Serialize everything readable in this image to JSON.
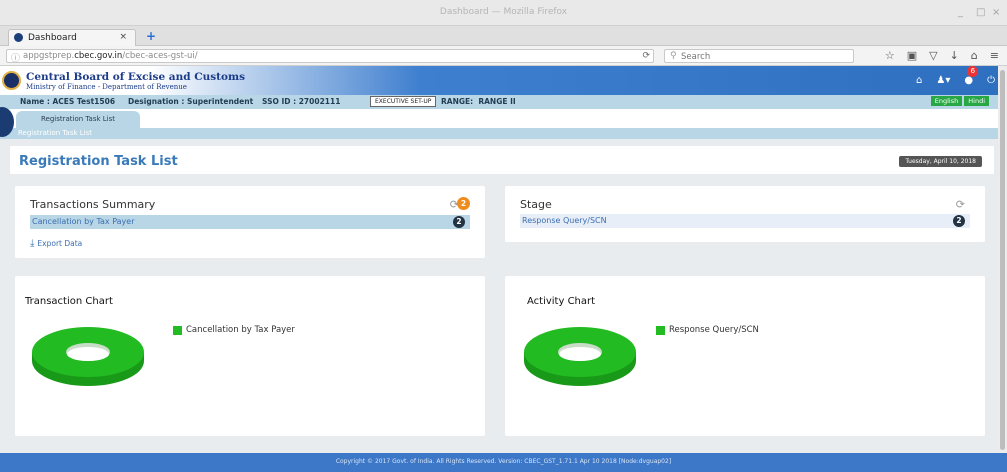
{
  "window": {
    "title": "Dashboard — Mozilla Firefox",
    "controls": [
      "_",
      "□",
      "×"
    ]
  },
  "browser": {
    "tab_label": "Dashboard",
    "tab_close": "×",
    "new_tab": "+",
    "url_prefix": "appgstprep.",
    "url_domain": "cbec.gov.in",
    "url_path": "/cbec-aces-gst-ui/",
    "search_placeholder": "Search",
    "icons": [
      "star-icon",
      "clipboard-icon",
      "pocket-icon",
      "download-icon",
      "home-icon",
      "menu-icon"
    ]
  },
  "header": {
    "org_name": "Central Board of Excise and Customs",
    "ministry": "Ministry of Finance - Department of Revenue",
    "notification_count": "6"
  },
  "infobar": {
    "name": "Name : ACES Test1506",
    "designation": "Designation : Superintendent",
    "sso": "SSO ID : 27002111",
    "exec_button": "EXECUTIVE SET-UP",
    "range": "RANGE:  RANGE II",
    "lang_en": "English",
    "lang_hi": "Hindi"
  },
  "nav": {
    "active_tab": "Registration Task List",
    "breadcrumb": "Registration Task List"
  },
  "page": {
    "title": "Registration Task List",
    "date": "Tuesday, April 10, 2018"
  },
  "transactions": {
    "title": "Transactions Summary",
    "total_badge": "2",
    "rows": [
      {
        "label": "Cancellation by Tax Payer",
        "count": "2"
      }
    ],
    "export_label": "Export Data"
  },
  "stage": {
    "title": "Stage",
    "rows": [
      {
        "label": "Response Query/SCN",
        "count": "2"
      }
    ]
  },
  "transaction_chart": {
    "title": "Transaction Chart",
    "legend": "Cancellation by Tax Payer",
    "color": "#22bb22"
  },
  "activity_chart": {
    "title": "Activity Chart",
    "legend": "Response Query/SCN",
    "color": "#22bb22"
  },
  "chart_data": [
    {
      "type": "pie",
      "title": "Transaction Chart",
      "categories": [
        "Cancellation by Tax Payer"
      ],
      "values": [
        2
      ],
      "donut": true,
      "legend": "right"
    },
    {
      "type": "pie",
      "title": "Activity Chart",
      "categories": [
        "Response Query/SCN"
      ],
      "values": [
        2
      ],
      "donut": true,
      "legend": "right"
    }
  ],
  "footer": {
    "text": "Copyright © 2017 Govt. of India. All Rights Reserved. Version: CBEC_GST_1.71.1 Apr 10 2018    [Node:dvguap02]"
  }
}
